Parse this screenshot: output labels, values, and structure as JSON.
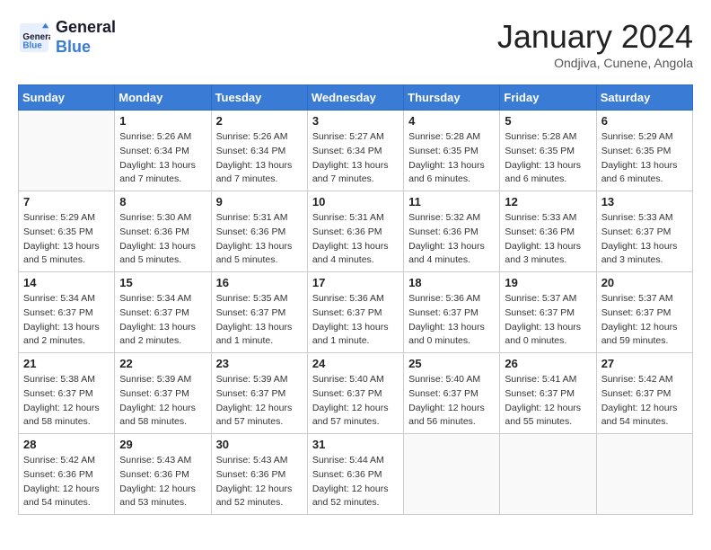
{
  "header": {
    "logo_line1": "General",
    "logo_line2": "Blue",
    "title": "January 2024",
    "subtitle": "Ondjiva, Cunene, Angola"
  },
  "weekdays": [
    "Sunday",
    "Monday",
    "Tuesday",
    "Wednesday",
    "Thursday",
    "Friday",
    "Saturday"
  ],
  "weeks": [
    [
      {
        "day": "",
        "sunrise": "",
        "sunset": "",
        "daylight": ""
      },
      {
        "day": "1",
        "sunrise": "Sunrise: 5:26 AM",
        "sunset": "Sunset: 6:34 PM",
        "daylight": "Daylight: 13 hours and 7 minutes."
      },
      {
        "day": "2",
        "sunrise": "Sunrise: 5:26 AM",
        "sunset": "Sunset: 6:34 PM",
        "daylight": "Daylight: 13 hours and 7 minutes."
      },
      {
        "day": "3",
        "sunrise": "Sunrise: 5:27 AM",
        "sunset": "Sunset: 6:34 PM",
        "daylight": "Daylight: 13 hours and 7 minutes."
      },
      {
        "day": "4",
        "sunrise": "Sunrise: 5:28 AM",
        "sunset": "Sunset: 6:35 PM",
        "daylight": "Daylight: 13 hours and 6 minutes."
      },
      {
        "day": "5",
        "sunrise": "Sunrise: 5:28 AM",
        "sunset": "Sunset: 6:35 PM",
        "daylight": "Daylight: 13 hours and 6 minutes."
      },
      {
        "day": "6",
        "sunrise": "Sunrise: 5:29 AM",
        "sunset": "Sunset: 6:35 PM",
        "daylight": "Daylight: 13 hours and 6 minutes."
      }
    ],
    [
      {
        "day": "7",
        "sunrise": "Sunrise: 5:29 AM",
        "sunset": "Sunset: 6:35 PM",
        "daylight": "Daylight: 13 hours and 5 minutes."
      },
      {
        "day": "8",
        "sunrise": "Sunrise: 5:30 AM",
        "sunset": "Sunset: 6:36 PM",
        "daylight": "Daylight: 13 hours and 5 minutes."
      },
      {
        "day": "9",
        "sunrise": "Sunrise: 5:31 AM",
        "sunset": "Sunset: 6:36 PM",
        "daylight": "Daylight: 13 hours and 5 minutes."
      },
      {
        "day": "10",
        "sunrise": "Sunrise: 5:31 AM",
        "sunset": "Sunset: 6:36 PM",
        "daylight": "Daylight: 13 hours and 4 minutes."
      },
      {
        "day": "11",
        "sunrise": "Sunrise: 5:32 AM",
        "sunset": "Sunset: 6:36 PM",
        "daylight": "Daylight: 13 hours and 4 minutes."
      },
      {
        "day": "12",
        "sunrise": "Sunrise: 5:33 AM",
        "sunset": "Sunset: 6:36 PM",
        "daylight": "Daylight: 13 hours and 3 minutes."
      },
      {
        "day": "13",
        "sunrise": "Sunrise: 5:33 AM",
        "sunset": "Sunset: 6:37 PM",
        "daylight": "Daylight: 13 hours and 3 minutes."
      }
    ],
    [
      {
        "day": "14",
        "sunrise": "Sunrise: 5:34 AM",
        "sunset": "Sunset: 6:37 PM",
        "daylight": "Daylight: 13 hours and 2 minutes."
      },
      {
        "day": "15",
        "sunrise": "Sunrise: 5:34 AM",
        "sunset": "Sunset: 6:37 PM",
        "daylight": "Daylight: 13 hours and 2 minutes."
      },
      {
        "day": "16",
        "sunrise": "Sunrise: 5:35 AM",
        "sunset": "Sunset: 6:37 PM",
        "daylight": "Daylight: 13 hours and 1 minute."
      },
      {
        "day": "17",
        "sunrise": "Sunrise: 5:36 AM",
        "sunset": "Sunset: 6:37 PM",
        "daylight": "Daylight: 13 hours and 1 minute."
      },
      {
        "day": "18",
        "sunrise": "Sunrise: 5:36 AM",
        "sunset": "Sunset: 6:37 PM",
        "daylight": "Daylight: 13 hours and 0 minutes."
      },
      {
        "day": "19",
        "sunrise": "Sunrise: 5:37 AM",
        "sunset": "Sunset: 6:37 PM",
        "daylight": "Daylight: 13 hours and 0 minutes."
      },
      {
        "day": "20",
        "sunrise": "Sunrise: 5:37 AM",
        "sunset": "Sunset: 6:37 PM",
        "daylight": "Daylight: 12 hours and 59 minutes."
      }
    ],
    [
      {
        "day": "21",
        "sunrise": "Sunrise: 5:38 AM",
        "sunset": "Sunset: 6:37 PM",
        "daylight": "Daylight: 12 hours and 58 minutes."
      },
      {
        "day": "22",
        "sunrise": "Sunrise: 5:39 AM",
        "sunset": "Sunset: 6:37 PM",
        "daylight": "Daylight: 12 hours and 58 minutes."
      },
      {
        "day": "23",
        "sunrise": "Sunrise: 5:39 AM",
        "sunset": "Sunset: 6:37 PM",
        "daylight": "Daylight: 12 hours and 57 minutes."
      },
      {
        "day": "24",
        "sunrise": "Sunrise: 5:40 AM",
        "sunset": "Sunset: 6:37 PM",
        "daylight": "Daylight: 12 hours and 57 minutes."
      },
      {
        "day": "25",
        "sunrise": "Sunrise: 5:40 AM",
        "sunset": "Sunset: 6:37 PM",
        "daylight": "Daylight: 12 hours and 56 minutes."
      },
      {
        "day": "26",
        "sunrise": "Sunrise: 5:41 AM",
        "sunset": "Sunset: 6:37 PM",
        "daylight": "Daylight: 12 hours and 55 minutes."
      },
      {
        "day": "27",
        "sunrise": "Sunrise: 5:42 AM",
        "sunset": "Sunset: 6:37 PM",
        "daylight": "Daylight: 12 hours and 54 minutes."
      }
    ],
    [
      {
        "day": "28",
        "sunrise": "Sunrise: 5:42 AM",
        "sunset": "Sunset: 6:36 PM",
        "daylight": "Daylight: 12 hours and 54 minutes."
      },
      {
        "day": "29",
        "sunrise": "Sunrise: 5:43 AM",
        "sunset": "Sunset: 6:36 PM",
        "daylight": "Daylight: 12 hours and 53 minutes."
      },
      {
        "day": "30",
        "sunrise": "Sunrise: 5:43 AM",
        "sunset": "Sunset: 6:36 PM",
        "daylight": "Daylight: 12 hours and 52 minutes."
      },
      {
        "day": "31",
        "sunrise": "Sunrise: 5:44 AM",
        "sunset": "Sunset: 6:36 PM",
        "daylight": "Daylight: 12 hours and 52 minutes."
      },
      {
        "day": "",
        "sunrise": "",
        "sunset": "",
        "daylight": ""
      },
      {
        "day": "",
        "sunrise": "",
        "sunset": "",
        "daylight": ""
      },
      {
        "day": "",
        "sunrise": "",
        "sunset": "",
        "daylight": ""
      }
    ]
  ]
}
